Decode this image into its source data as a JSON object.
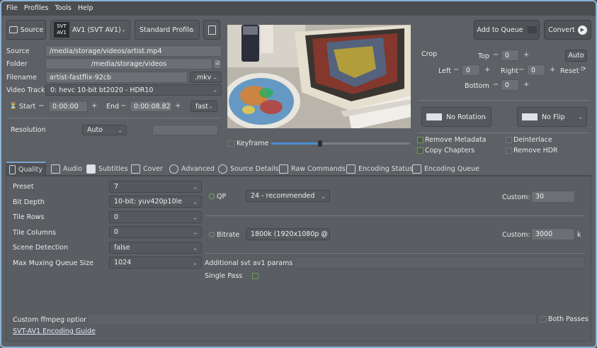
{
  "menu": [
    "File",
    "Profiles",
    "Tools",
    "Help"
  ],
  "toolbar": {
    "source_label": "Source",
    "encoder": "AV1 (SVT AV1)",
    "profile": "Standard Profile",
    "add_queue_label": "Add to Queue",
    "convert_label": "Convert"
  },
  "file": {
    "source_label": "Source",
    "source_value": "/media/storage/videos/artist.mp4",
    "folder_label": "Folder",
    "folder_value": "/media/storage/videos",
    "filename_label": "Filename",
    "filename_value": "artist-fastflix-92cb",
    "extension": ".mkv",
    "video_track_label": "Video Track",
    "video_track_value": "0: hevc 10-bit bt2020 - HDR10",
    "start_label": "Start",
    "start_value": "0:00:00",
    "end_label": "End",
    "end_value": "0:00:08.82",
    "seek_speed": "fast",
    "resolution_label": "Resolution",
    "resolution_value": "Auto"
  },
  "preview": {
    "keyframe_label": "Keyframe",
    "slider_fraction": 0.35
  },
  "crop": {
    "title": "Crop",
    "top_label": "Top",
    "top_value": "0",
    "left_label": "Left",
    "left_value": "0",
    "right_label": "Right",
    "right_value": "0",
    "bottom_label": "Bottom",
    "bottom_value": "0",
    "auto_label": "Auto",
    "reset_label": "Reset"
  },
  "transform": {
    "rotation": "No Rotation",
    "flip": "No Flip",
    "remove_metadata": "Remove Metadata",
    "copy_chapters": "Copy Chapters",
    "deinterlace": "Deinterlace",
    "remove_hdr": "Remove HDR"
  },
  "tabs": [
    "Quality",
    "Audio",
    "Subtitles",
    "Cover",
    "Advanced",
    "Source Details",
    "Raw Commands",
    "Encoding Status",
    "Encoding Queue"
  ],
  "quality": {
    "preset_label": "Preset",
    "preset_value": "7",
    "bit_depth_label": "Bit Depth",
    "bit_depth_value": "10-bit: yuv420p10le",
    "tile_rows_label": "Tile Rows",
    "tile_rows_value": "0",
    "tile_columns_label": "Tile Columns",
    "tile_columns_value": "0",
    "scene_detection_label": "Scene Detection",
    "scene_detection_value": "false",
    "max_mux_label": "Max Muxing Queue Size",
    "max_mux_value": "1024",
    "qp_label": "QP",
    "qp_value": "24 - recommended",
    "qp_custom_label": "Custom:",
    "qp_custom_value": "30",
    "bitrate_label": "Bitrate",
    "bitrate_value": "1800k (1920x1080p @",
    "bitrate_custom_label": "Custom:",
    "bitrate_custom_value": "3000",
    "bitrate_unit": "k",
    "additional_label": "Additional svt av1 params",
    "single_pass_label": "Single Pass",
    "ffmpeg_label": "Custom ffmpeg options",
    "both_passes_label": "Both Passes",
    "guide_link": "SVT-AV1 Encoding Guide"
  }
}
